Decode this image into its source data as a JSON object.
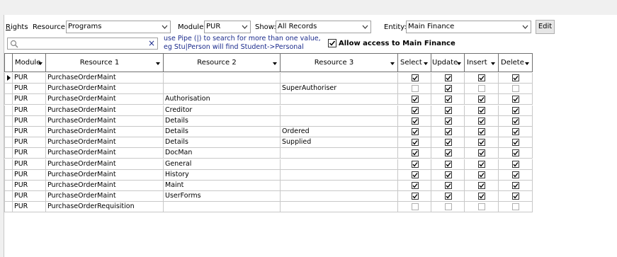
{
  "toolbar": {
    "rights_label": "Rights",
    "rights_underline": "R",
    "rights_rest": "ights",
    "resource_label": "Resource:",
    "resource_value": "Programs",
    "module_label": "Module:",
    "module_value": "PUR",
    "show_label": "Show:",
    "show_value": "All Records",
    "entity_label": "Entity:",
    "entity_value": "Main Finance",
    "edit_button": "Edit",
    "search_placeholder": "",
    "search_value": "",
    "clear_icon": "×",
    "hint_line1": "use Pipe (|) to search for more than one value,",
    "hint_line2": "eg Stu|Person will find Student->Personal",
    "allow_access_label": "Allow access to Main Finance",
    "allow_access_checked": true
  },
  "grid": {
    "columns": [
      {
        "key": "module",
        "label": "Module"
      },
      {
        "key": "resource1",
        "label": "Resource 1"
      },
      {
        "key": "resource2",
        "label": "Resource 2"
      },
      {
        "key": "resource3",
        "label": "Resource 3"
      },
      {
        "key": "select",
        "label": "Select"
      },
      {
        "key": "update",
        "label": "Update"
      },
      {
        "key": "insert",
        "label": "Insert"
      },
      {
        "key": "delete",
        "label": "Delete"
      }
    ],
    "rows": [
      {
        "module": "PUR",
        "resource1": "PurchaseOrderMaint",
        "resource2": "",
        "resource3": "",
        "select": true,
        "update": true,
        "insert": true,
        "delete": true,
        "current": true
      },
      {
        "module": "PUR",
        "resource1": "PurchaseOrderMaint",
        "resource2": "",
        "resource3": "SuperAuthoriser",
        "select": false,
        "update": true,
        "insert": false,
        "delete": false
      },
      {
        "module": "PUR",
        "resource1": "PurchaseOrderMaint",
        "resource2": "Authorisation",
        "resource3": "",
        "select": true,
        "update": true,
        "insert": true,
        "delete": true
      },
      {
        "module": "PUR",
        "resource1": "PurchaseOrderMaint",
        "resource2": "Creditor",
        "resource3": "",
        "select": true,
        "update": true,
        "insert": true,
        "delete": true
      },
      {
        "module": "PUR",
        "resource1": "PurchaseOrderMaint",
        "resource2": "Details",
        "resource3": "",
        "select": true,
        "update": true,
        "insert": true,
        "delete": true
      },
      {
        "module": "PUR",
        "resource1": "PurchaseOrderMaint",
        "resource2": "Details",
        "resource3": "Ordered",
        "select": true,
        "update": true,
        "insert": true,
        "delete": true
      },
      {
        "module": "PUR",
        "resource1": "PurchaseOrderMaint",
        "resource2": "Details",
        "resource3": "Supplied",
        "select": true,
        "update": true,
        "insert": true,
        "delete": true
      },
      {
        "module": "PUR",
        "resource1": "PurchaseOrderMaint",
        "resource2": "DocMan",
        "resource3": "",
        "select": true,
        "update": true,
        "insert": true,
        "delete": true
      },
      {
        "module": "PUR",
        "resource1": "PurchaseOrderMaint",
        "resource2": "General",
        "resource3": "",
        "select": true,
        "update": true,
        "insert": true,
        "delete": true
      },
      {
        "module": "PUR",
        "resource1": "PurchaseOrderMaint",
        "resource2": "History",
        "resource3": "",
        "select": true,
        "update": true,
        "insert": true,
        "delete": true
      },
      {
        "module": "PUR",
        "resource1": "PurchaseOrderMaint",
        "resource2": "Maint",
        "resource3": "",
        "select": true,
        "update": true,
        "insert": true,
        "delete": true
      },
      {
        "module": "PUR",
        "resource1": "PurchaseOrderMaint",
        "resource2": "UserForms",
        "resource3": "",
        "select": true,
        "update": true,
        "insert": true,
        "delete": true
      },
      {
        "module": "PUR",
        "resource1": "PurchaseOrderRequisition",
        "resource2": "",
        "resource3": "",
        "select": false,
        "update": false,
        "insert": false,
        "delete": false
      }
    ]
  },
  "icons": {
    "search": "search-icon",
    "clear": "close-icon",
    "dropdown": "chevron-down-icon",
    "row_pointer": "row-pointer-icon",
    "checkbox": "checkbox-icon"
  },
  "colors": {
    "hint_text": "#1a2a8c",
    "frame": "#f0f0f0",
    "grid_line": "#c8c8c8"
  }
}
